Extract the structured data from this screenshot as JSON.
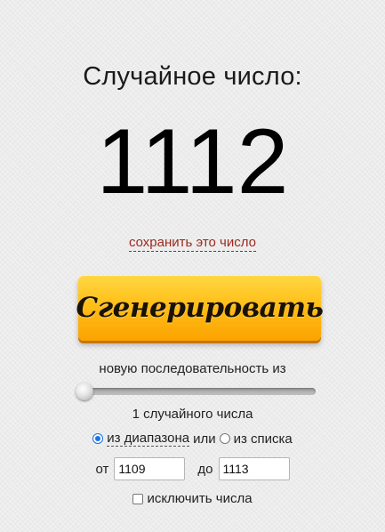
{
  "heading": "Случайное число:",
  "result": "1112",
  "save_link": "сохранить это число",
  "generate_button": "Сгенерировать",
  "sequence_label": "новую последовательность из",
  "slider": {
    "value": 1,
    "min": 1,
    "level": 0
  },
  "count_label": "1 случайного числа",
  "mode": {
    "range_label": "из диапазона",
    "or_label": "или",
    "list_label": "из списка",
    "selected": "range"
  },
  "range": {
    "from_label": "от",
    "from_value": "1109",
    "to_label": "до",
    "to_value": "1113"
  },
  "exclude_label": "исключить числа",
  "colors": {
    "link": "#9b2a1d",
    "button": "#ffbf18",
    "radio_active": "#1a73e8"
  }
}
